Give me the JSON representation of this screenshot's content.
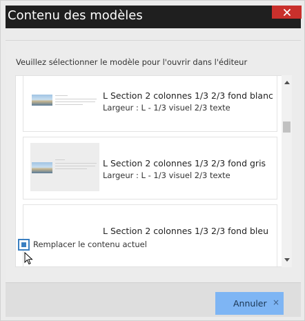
{
  "dialog": {
    "title": "Contenu des modèles",
    "close_icon": "close-icon"
  },
  "content": {
    "prompt": "Veuillez sélectionner le modèle pour l'ouvrir dans l'éditeur",
    "templates": [
      {
        "name": "L Section 2 colonnes 1/3 2/3 fond blanc",
        "description": "Largeur : L - 1/3 visuel 2/3 texte"
      },
      {
        "name": "L Section 2 colonnes 1/3 2/3 fond gris",
        "description": "Largeur : L - 1/3 visuel 2/3 texte"
      },
      {
        "name": "L Section 2 colonnes 1/3 2/3 fond bleu",
        "description": ""
      }
    ],
    "replace_checkbox": {
      "label": "Remplacer le contenu actuel",
      "checked": true
    }
  },
  "footer": {
    "cancel_label": "Annuler",
    "cancel_icon": "×"
  }
}
